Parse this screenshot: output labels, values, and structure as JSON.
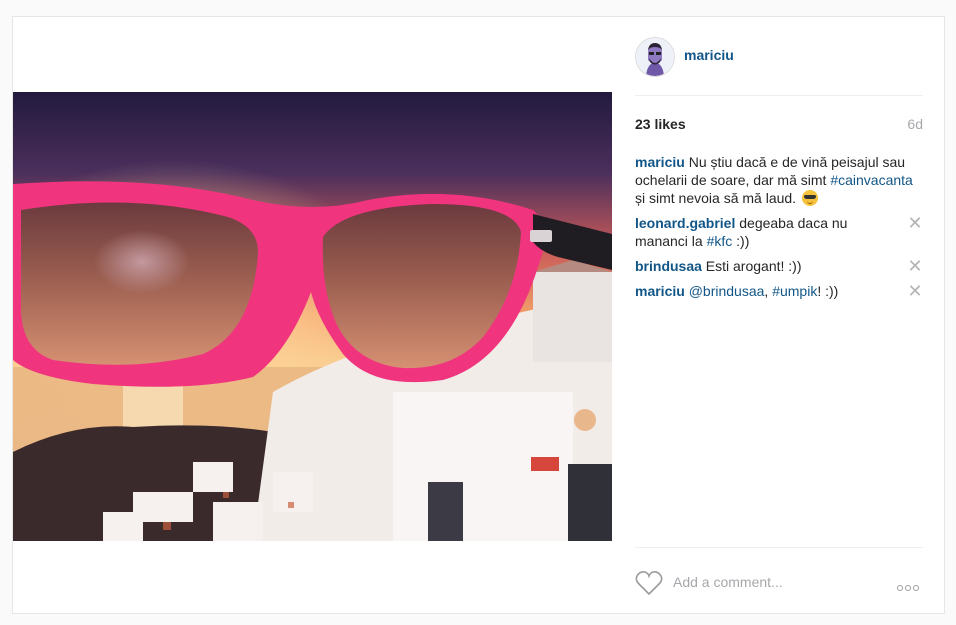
{
  "post": {
    "username": "mariciu",
    "likes": "23 likes",
    "age": "6d",
    "caption": {
      "user": "mariciu",
      "text_before": " Nu știu dacă e de vină peisajul sau ochelarii de soare, dar mă simt ",
      "hashtag": "#cainvacanta",
      "text_after": " și simt nevoia să mă laud. ",
      "emoji": "sunglasses-smiley"
    },
    "comments": [
      {
        "user": "leonard.gabriel",
        "text": " degeaba daca nu mananci la ",
        "tag": "#kfc",
        "text_after": " :))"
      },
      {
        "user": "brindusaa",
        "text": " Esti arogant! :))"
      },
      {
        "user": "mariciu",
        "mention": " @brindusaa",
        "text": ", ",
        "tag": "#umpik",
        "text_after": "! :))"
      }
    ],
    "add_comment_placeholder": "Add a comment...",
    "icons": {
      "delete": "close-icon",
      "like": "heart-outline-icon",
      "more": "more-options-icon"
    },
    "colors": {
      "link": "#125688",
      "muted": "#a5a7aa",
      "frame_pink": "#f0347d"
    }
  }
}
